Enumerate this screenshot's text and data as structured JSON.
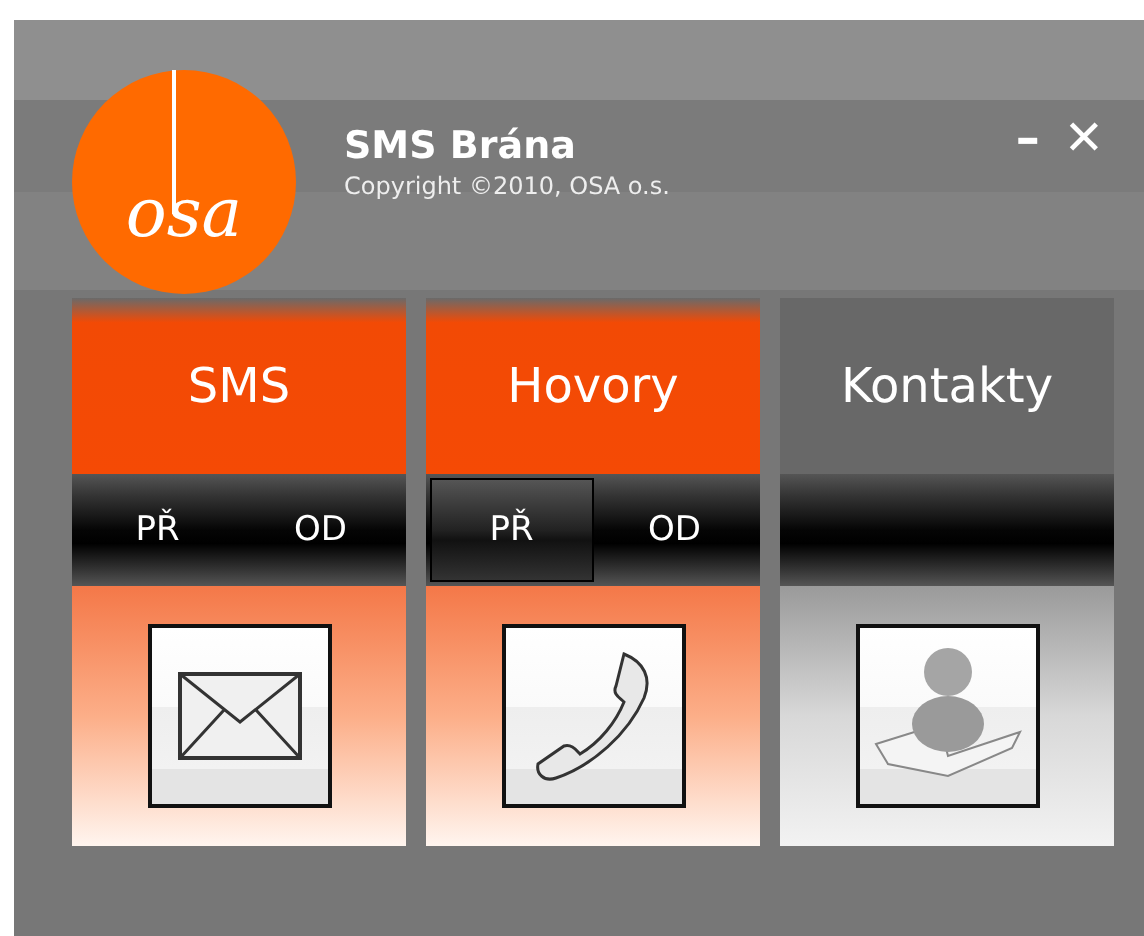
{
  "window": {
    "title": "SMS Brána",
    "subtitle": "Copyright ©2010, OSA o.s.",
    "logo_text": "osa",
    "minimize": "–",
    "close": "✕"
  },
  "panels": [
    {
      "title": "SMS",
      "highlighted": true,
      "kind": "message",
      "buttons": [
        {
          "label": "PŘ",
          "selected": false
        },
        {
          "label": "OD",
          "selected": false
        }
      ]
    },
    {
      "title": "Hovory",
      "highlighted": true,
      "kind": "phone",
      "buttons": [
        {
          "label": "PŘ",
          "selected": true
        },
        {
          "label": "OD",
          "selected": false
        }
      ]
    },
    {
      "title": "Kontakty",
      "highlighted": false,
      "kind": "contacts"
    }
  ]
}
